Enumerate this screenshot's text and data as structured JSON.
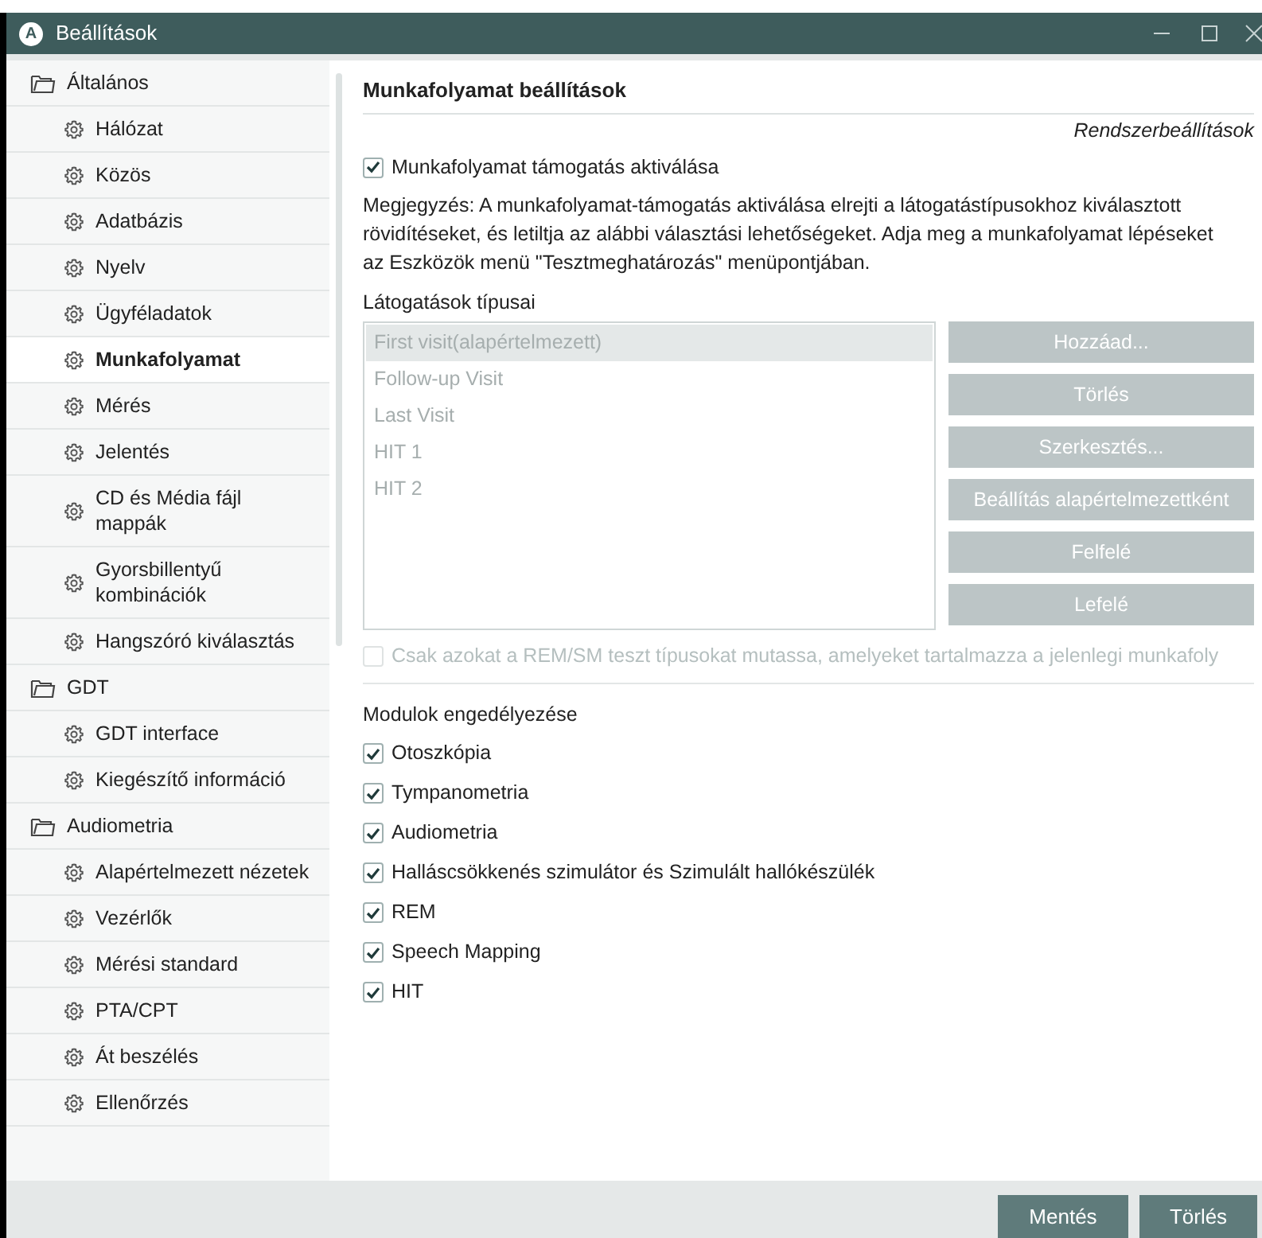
{
  "window": {
    "title": "Beállítások",
    "app_letter": "A"
  },
  "sidebar": {
    "items": [
      {
        "label": "Általános",
        "selected": false,
        "children": [
          {
            "label": "Hálózat",
            "selected": false
          },
          {
            "label": "Közös",
            "selected": false
          },
          {
            "label": "Adatbázis",
            "selected": false
          },
          {
            "label": "Nyelv",
            "selected": false
          },
          {
            "label": "Ügyféladatok",
            "selected": false
          },
          {
            "label": "Munkafolyamat",
            "selected": true
          },
          {
            "label": "Mérés",
            "selected": false
          },
          {
            "label": "Jelentés",
            "selected": false
          },
          {
            "label": "CD és Média fájl mappák",
            "selected": false
          },
          {
            "label": "Gyorsbillentyű kombinációk",
            "selected": false
          },
          {
            "label": "Hangszóró kiválasztás",
            "selected": false
          }
        ]
      },
      {
        "label": "GDT",
        "selected": false,
        "children": [
          {
            "label": "GDT interface",
            "selected": false
          },
          {
            "label": "Kiegészítő információ",
            "selected": false
          }
        ]
      },
      {
        "label": "Audiometria",
        "selected": false,
        "children": [
          {
            "label": "Alapértelmezett nézetek",
            "selected": false
          },
          {
            "label": "Vezérlők",
            "selected": false
          },
          {
            "label": "Mérési standard",
            "selected": false
          },
          {
            "label": "PTA/CPT",
            "selected": false
          },
          {
            "label": "Át beszélés",
            "selected": false
          },
          {
            "label": "Ellenőrzés",
            "selected": false
          }
        ]
      }
    ]
  },
  "panel": {
    "title": "Munkafolyamat beállítások",
    "scope": "Rendszerbeállítások",
    "workflow_checkbox": {
      "label": "Munkafolyamat támogatás aktiválása",
      "checked": true
    },
    "note": "Megjegyzés: A munkafolyamat-támogatás aktiválása elrejti a látogatástípusokhoz kiválasztott rövidítéseket, és letiltja az alábbi választási lehetőségeket. Adja meg a munkafolyamat lépéseket az Eszközök menü \"Tesztmeghatározás\" menüpontjában.",
    "visit_types": {
      "label": "Látogatások típusai",
      "disabled": true,
      "items": [
        {
          "label": "First visit(alapértelmezett)",
          "selected": true
        },
        {
          "label": "Follow-up Visit",
          "selected": false
        },
        {
          "label": "Last Visit",
          "selected": false
        },
        {
          "label": "HIT 1",
          "selected": false
        },
        {
          "label": "HIT 2",
          "selected": false
        }
      ]
    },
    "visit_buttons": [
      {
        "label": "Hozzáad...",
        "disabled": true
      },
      {
        "label": "Törlés",
        "disabled": true
      },
      {
        "label": "Szerkesztés...",
        "disabled": true
      },
      {
        "label": "Beállítás alapértelmezettként",
        "disabled": true
      },
      {
        "label": "Felfelé",
        "disabled": true
      },
      {
        "label": "Lefelé",
        "disabled": true
      }
    ],
    "rem_checkbox": {
      "label": "Csak azokat a REM/SM teszt típusokat mutassa, amelyeket tartalmazza a jelenlegi munkafoly",
      "checked": false,
      "disabled": true
    },
    "modules": {
      "label": "Modulok engedélyezése",
      "items": [
        {
          "label": "Otoszkópia",
          "checked": true
        },
        {
          "label": "Tympanometria",
          "checked": true
        },
        {
          "label": "Audiometria",
          "checked": true
        },
        {
          "label": "Halláscsökkenés szimulátor és Szimulált hallókészülék",
          "checked": true
        },
        {
          "label": "REM",
          "checked": true
        },
        {
          "label": "Speech Mapping",
          "checked": true
        },
        {
          "label": "HIT",
          "checked": true
        }
      ]
    }
  },
  "footer": {
    "buttons": [
      {
        "label": "Mentés"
      },
      {
        "label": "Törlés"
      }
    ]
  }
}
